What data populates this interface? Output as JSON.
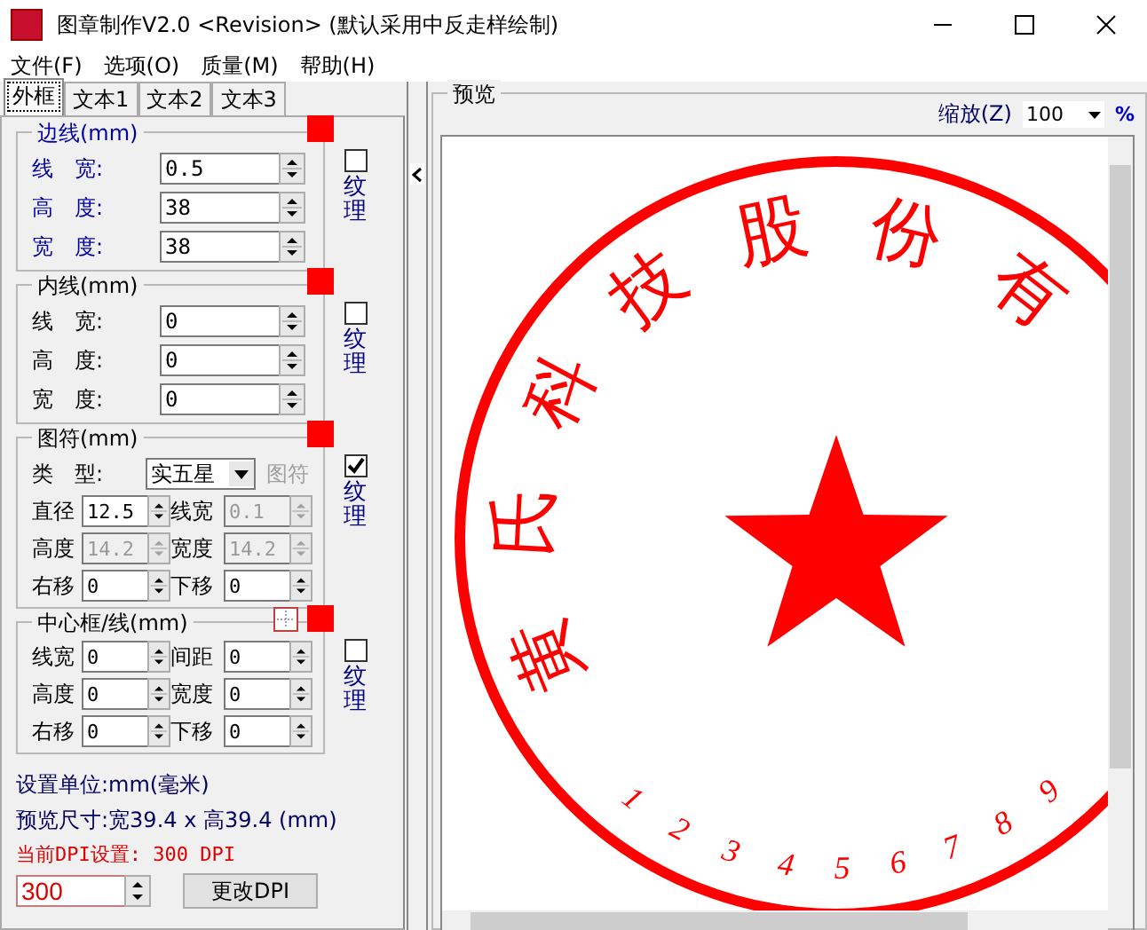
{
  "window": {
    "title": "图章制作V2.0 <Revision> (默认采用中反走样绘制)"
  },
  "menu": [
    "文件(F)",
    "选项(O)",
    "质量(M)",
    "帮助(H)"
  ],
  "tabs": [
    {
      "label": "外框",
      "selected": true
    },
    {
      "label": "文本1",
      "selected": false
    },
    {
      "label": "文本2",
      "selected": false
    },
    {
      "label": "文本3",
      "selected": false
    }
  ],
  "groups": [
    {
      "kind": "rows",
      "title": "边线(mm)",
      "highlighted": true,
      "color": "#ff0000",
      "texture": {
        "label": "纹理",
        "checked": false
      },
      "fields": [
        {
          "label": "线　宽:",
          "value": "0.5",
          "disabled": false
        },
        {
          "label": "高　度:",
          "value": "38",
          "disabled": false
        },
        {
          "label": "宽　度:",
          "value": "38",
          "disabled": false
        }
      ]
    },
    {
      "kind": "rows",
      "title": "内线(mm)",
      "highlighted": false,
      "color": "#ff0000",
      "texture": {
        "label": "纹理",
        "checked": false
      },
      "fields": [
        {
          "label": "线　宽:",
          "value": "0",
          "disabled": false
        },
        {
          "label": "高　度:",
          "value": "0",
          "disabled": false
        },
        {
          "label": "宽　度:",
          "value": "0",
          "disabled": false
        }
      ]
    },
    {
      "kind": "symbol",
      "title": "图符(mm)",
      "highlighted": false,
      "color": "#ff0000",
      "texture": {
        "label": "纹理",
        "checked": true
      },
      "type_label": "类　型:",
      "type_value": "实五星",
      "symbol_button": {
        "label": "图符",
        "disabled": true
      },
      "fields": [
        {
          "label": "直径",
          "value": "12.5",
          "disabled": false
        },
        {
          "label": "线宽",
          "value": "0.1",
          "disabled": true
        },
        {
          "label": "高度",
          "value": "14.2",
          "disabled": true
        },
        {
          "label": "宽度",
          "value": "14.2",
          "disabled": true
        },
        {
          "label": "右移",
          "value": "0",
          "disabled": false
        },
        {
          "label": "下移",
          "value": "0",
          "disabled": false
        }
      ]
    },
    {
      "kind": "grid",
      "title": "中心框/线(mm)",
      "highlighted": false,
      "color": "#ff0000",
      "texture": {
        "label": "纹理",
        "checked": false
      },
      "fields": [
        {
          "label": "线宽",
          "value": "0",
          "disabled": false
        },
        {
          "label": "间距",
          "value": "0",
          "disabled": false
        },
        {
          "label": "高度",
          "value": "0",
          "disabled": false
        },
        {
          "label": "宽度",
          "value": "0",
          "disabled": false
        },
        {
          "label": "右移",
          "value": "0",
          "disabled": false
        },
        {
          "label": "下移",
          "value": "0",
          "disabled": false
        }
      ]
    }
  ],
  "info": [
    {
      "kind": "plain",
      "text": "设置单位:mm(毫米)"
    },
    {
      "kind": "plain",
      "text": "预览尺寸:宽39.4 x 高39.4 (mm)"
    },
    {
      "kind": "alert",
      "text": "当前DPI设置: 300 DPI"
    }
  ],
  "dpi": {
    "value": "300",
    "button": "更改DPI"
  },
  "preview": {
    "title": "预览",
    "zoom_label": "缩放(Z)",
    "zoom_value": "100",
    "zoom_unit": "%",
    "stamp": {
      "arc_text": [
        "黄",
        "氏",
        "科",
        "技",
        "股",
        "份",
        "有"
      ],
      "digits": [
        "1",
        "2",
        "3",
        "4",
        "5",
        "6",
        "7",
        "8",
        "9"
      ]
    }
  }
}
